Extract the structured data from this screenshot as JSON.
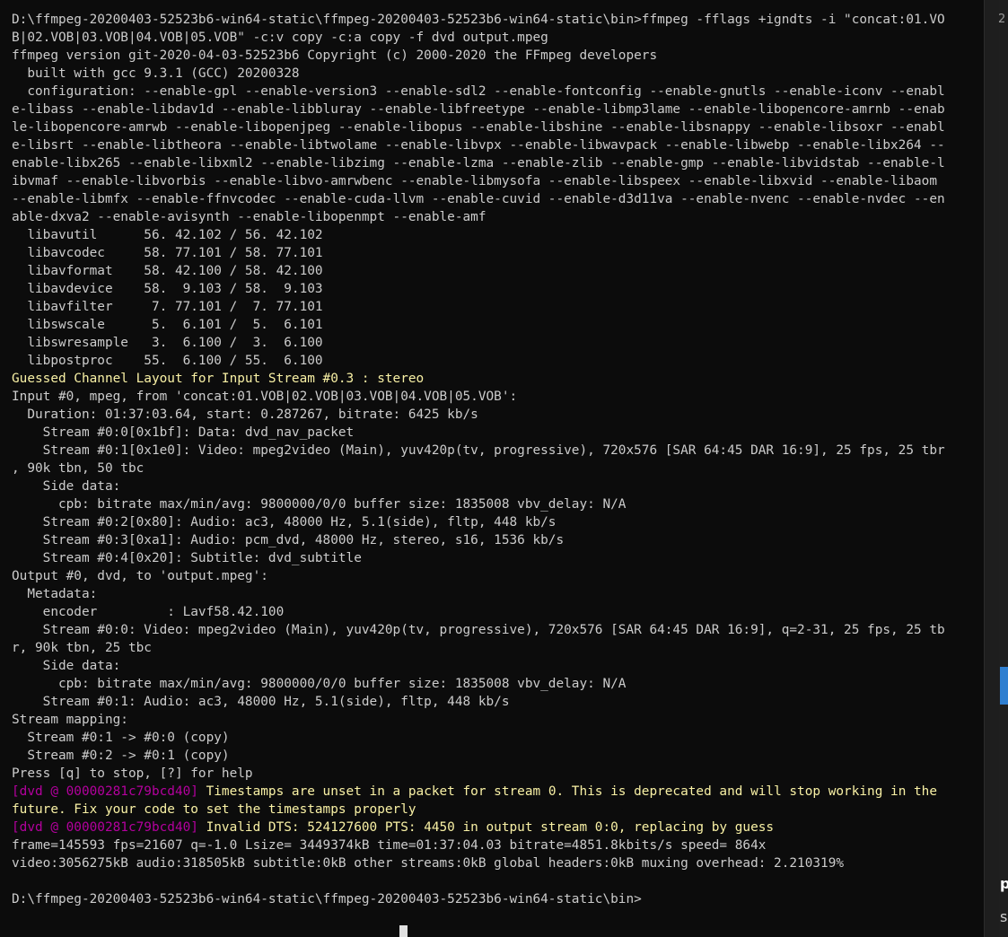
{
  "console": {
    "lines": [
      {
        "text": "D:\\ffmpeg-20200403-52523b6-win64-static\\ffmpeg-20200403-52523b6-win64-static\\bin>ffmpeg -fflags +igndts -i \"concat:01.VO"
      },
      {
        "text": "B|02.VOB|03.VOB|04.VOB|05.VOB\" -c:v copy -c:a copy -f dvd output.mpeg"
      },
      {
        "text": "ffmpeg version git-2020-04-03-52523b6 Copyright (c) 2000-2020 the FFmpeg developers"
      },
      {
        "text": "  built with gcc 9.3.1 (GCC) 20200328"
      },
      {
        "text": "  configuration: --enable-gpl --enable-version3 --enable-sdl2 --enable-fontconfig --enable-gnutls --enable-iconv --enabl"
      },
      {
        "text": "e-libass --enable-libdav1d --enable-libbluray --enable-libfreetype --enable-libmp3lame --enable-libopencore-amrnb --enab"
      },
      {
        "text": "le-libopencore-amrwb --enable-libopenjpeg --enable-libopus --enable-libshine --enable-libsnappy --enable-libsoxr --enabl"
      },
      {
        "text": "e-libsrt --enable-libtheora --enable-libtwolame --enable-libvpx --enable-libwavpack --enable-libwebp --enable-libx264 --"
      },
      {
        "text": "enable-libx265 --enable-libxml2 --enable-libzimg --enable-lzma --enable-zlib --enable-gmp --enable-libvidstab --enable-l"
      },
      {
        "text": "ibvmaf --enable-libvorbis --enable-libvo-amrwbenc --enable-libmysofa --enable-libspeex --enable-libxvid --enable-libaom"
      },
      {
        "text": "--enable-libmfx --enable-ffnvcodec --enable-cuda-llvm --enable-cuvid --enable-d3d11va --enable-nvenc --enable-nvdec --en"
      },
      {
        "text": "able-dxva2 --enable-avisynth --enable-libopenmpt --enable-amf"
      },
      {
        "text": "  libavutil      56. 42.102 / 56. 42.102"
      },
      {
        "text": "  libavcodec     58. 77.101 / 58. 77.101"
      },
      {
        "text": "  libavformat    58. 42.100 / 58. 42.100"
      },
      {
        "text": "  libavdevice    58.  9.103 / 58.  9.103"
      },
      {
        "text": "  libavfilter     7. 77.101 /  7. 77.101"
      },
      {
        "text": "  libswscale      5.  6.101 /  5.  6.101"
      },
      {
        "text": "  libswresample   3.  6.100 /  3.  6.100"
      },
      {
        "text": "  libpostproc    55.  6.100 / 55.  6.100"
      },
      {
        "text": "Guessed Channel Layout for Input Stream #0.3 : stereo",
        "style": "yellow"
      },
      {
        "text": "Input #0, mpeg, from 'concat:01.VOB|02.VOB|03.VOB|04.VOB|05.VOB':"
      },
      {
        "text": "  Duration: 01:37:03.64, start: 0.287267, bitrate: 6425 kb/s"
      },
      {
        "text": "    Stream #0:0[0x1bf]: Data: dvd_nav_packet"
      },
      {
        "text": "    Stream #0:1[0x1e0]: Video: mpeg2video (Main), yuv420p(tv, progressive), 720x576 [SAR 64:45 DAR 16:9], 25 fps, 25 tbr"
      },
      {
        "text": ", 90k tbn, 50 tbc"
      },
      {
        "text": "    Side data:"
      },
      {
        "text": "      cpb: bitrate max/min/avg: 9800000/0/0 buffer size: 1835008 vbv_delay: N/A"
      },
      {
        "text": "    Stream #0:2[0x80]: Audio: ac3, 48000 Hz, 5.1(side), fltp, 448 kb/s"
      },
      {
        "text": "    Stream #0:3[0xa1]: Audio: pcm_dvd, 48000 Hz, stereo, s16, 1536 kb/s"
      },
      {
        "text": "    Stream #0:4[0x20]: Subtitle: dvd_subtitle"
      },
      {
        "text": "Output #0, dvd, to 'output.mpeg':"
      },
      {
        "text": "  Metadata:"
      },
      {
        "text": "    encoder         : Lavf58.42.100"
      },
      {
        "text": "    Stream #0:0: Video: mpeg2video (Main), yuv420p(tv, progressive), 720x576 [SAR 64:45 DAR 16:9], q=2-31, 25 fps, 25 tb"
      },
      {
        "text": "r, 90k tbn, 25 tbc"
      },
      {
        "text": "    Side data:"
      },
      {
        "text": "      cpb: bitrate max/min/avg: 9800000/0/0 buffer size: 1835008 vbv_delay: N/A"
      },
      {
        "text": "    Stream #0:1: Audio: ac3, 48000 Hz, 5.1(side), fltp, 448 kb/s"
      },
      {
        "text": "Stream mapping:"
      },
      {
        "text": "  Stream #0:1 -> #0:0 (copy)"
      },
      {
        "text": "  Stream #0:2 -> #0:1 (copy)"
      },
      {
        "text": "Press [q] to stop, [?] for help"
      },
      {
        "prefix": "[dvd @ 00000281c79bcd40]",
        "text": " Timestamps are unset in a packet for stream 0. This is deprecated and will stop working in the",
        "style": "yellow"
      },
      {
        "text": "future. Fix your code to set the timestamps properly",
        "style": "yellow"
      },
      {
        "prefix": "[dvd @ 00000281c79bcd40]",
        "text": " Invalid DTS: 524127600 PTS: 4450 in output stream 0:0, replacing by guess",
        "style": "yellow"
      },
      {
        "text": "frame=145593 fps=21607 q=-1.0 Lsize= 3449374kB time=01:37:04.03 bitrate=4851.8kbits/s speed= 864x"
      },
      {
        "text": "video:3056275kB audio:318505kB subtitle:0kB other streams:0kB global headers:0kB muxing overhead: 2.210319%"
      },
      {
        "text": ""
      },
      {
        "text": "D:\\ffmpeg-20200403-52523b6-win64-static\\ffmpeg-20200403-52523b6-win64-static\\bin>"
      }
    ]
  },
  "side": {
    "top_glyph": "2",
    "glyph_mid": "p",
    "glyph_bottom": "s"
  },
  "colors": {
    "background": "#0c0c0c",
    "text": "#cccccc",
    "warning": "#f9f1a5",
    "log_prefix": "#b4009e",
    "scroll_thumb": "#2f7fd0"
  }
}
